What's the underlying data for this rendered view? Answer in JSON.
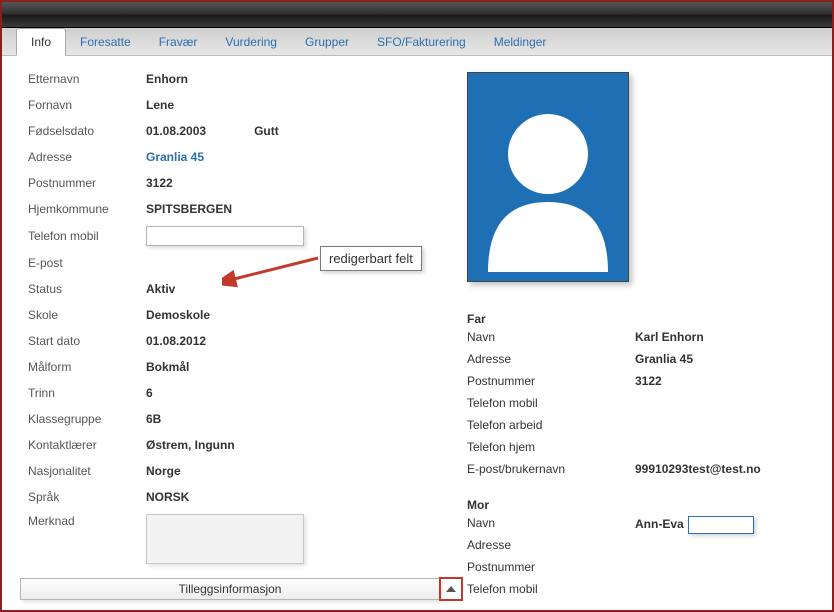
{
  "tabs": [
    "Info",
    "Foresatte",
    "Fravær",
    "Vurdering",
    "Grupper",
    "SFO/Fakturering",
    "Meldinger"
  ],
  "active_tab": 0,
  "labels": {
    "etternavn": "Etternavn",
    "fornav": "Fornavn",
    "fodselsdato": "Fødselsdato",
    "adresse": "Adresse",
    "postnummer": "Postnummer",
    "hjemkommune": "Hjemkommune",
    "telefon_mobil": "Telefon mobil",
    "epost": "E-post",
    "status": "Status",
    "skole": "Skole",
    "startdato": "Start dato",
    "malform": "Målform",
    "trinn": "Trinn",
    "klassegruppe": "Klassegruppe",
    "kontaktlarer": "Kontaktlærer",
    "nasjonalitet": "Nasjonalitet",
    "sprak": "Språk",
    "merknad": "Merknad"
  },
  "student": {
    "etternavn": "Enhorn",
    "fornav": "Lene",
    "fodselsdato": "01.08.2003",
    "kjonn": "Gutt",
    "adresse": "Granlia 45",
    "postnummer": "3122",
    "hjemkommune": "SPITSBERGEN",
    "telefon_mobil": "",
    "epost": "",
    "status": "Aktiv",
    "skole": "Demoskole",
    "startdato": "01.08.2012",
    "malform": "Bokmål",
    "trinn": "6",
    "klassegruppe": "6B",
    "kontaktlarer": "Østrem, Ingunn",
    "nasjonalitet": "Norge",
    "sprak": "NORSK",
    "merknad": ""
  },
  "callout": "redigerbart felt",
  "far": {
    "heading": "Far",
    "labels": {
      "navn": "Navn",
      "adresse": "Adresse",
      "postnummer": "Postnummer",
      "telefon_mobil": "Telefon mobil",
      "telefon_arbeid": "Telefon arbeid",
      "telefon_hjem": "Telefon hjem",
      "epost_bruker": "E-post/brukernavn"
    },
    "navn": "Karl Enhorn",
    "adresse": "Granlia 45",
    "postnummer": "3122",
    "telefon_mobil": "",
    "telefon_arbeid": "",
    "telefon_hjem": "",
    "epost_bruker": "99910293test@test.no"
  },
  "mor": {
    "heading": "Mor",
    "labels": {
      "navn": "Navn",
      "adresse": "Adresse",
      "postnummer": "Postnummer",
      "telefon_mobil": "Telefon mobil"
    },
    "navn": "Ann-Eva",
    "adresse": "",
    "postnummer": "",
    "telefon_mobil": ""
  },
  "footer": {
    "label": "Tilleggsinformasjon"
  }
}
